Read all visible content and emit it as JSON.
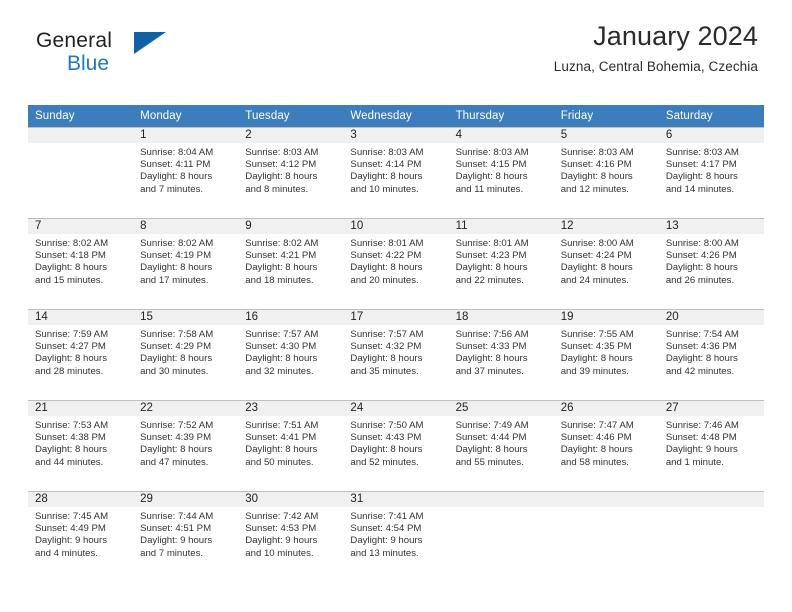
{
  "brand": {
    "name_top": "General",
    "name_bottom": "Blue"
  },
  "header": {
    "title": "January 2024",
    "subtitle": "Luzna, Central Bohemia, Czechia"
  },
  "colors": {
    "header_blue": "#3b7dbd",
    "logo_blue": "#1f78c1",
    "daynum_band": "#f0f0f0",
    "grid_line": "#bfbfbf"
  },
  "weekdays": [
    "Sunday",
    "Monday",
    "Tuesday",
    "Wednesday",
    "Thursday",
    "Friday",
    "Saturday"
  ],
  "weeks": [
    [
      {
        "day": "",
        "sunrise": "",
        "sunset": "",
        "daylight1": "",
        "daylight2": ""
      },
      {
        "day": "1",
        "sunrise": "Sunrise: 8:04 AM",
        "sunset": "Sunset: 4:11 PM",
        "daylight1": "Daylight: 8 hours",
        "daylight2": "and 7 minutes."
      },
      {
        "day": "2",
        "sunrise": "Sunrise: 8:03 AM",
        "sunset": "Sunset: 4:12 PM",
        "daylight1": "Daylight: 8 hours",
        "daylight2": "and 8 minutes."
      },
      {
        "day": "3",
        "sunrise": "Sunrise: 8:03 AM",
        "sunset": "Sunset: 4:14 PM",
        "daylight1": "Daylight: 8 hours",
        "daylight2": "and 10 minutes."
      },
      {
        "day": "4",
        "sunrise": "Sunrise: 8:03 AM",
        "sunset": "Sunset: 4:15 PM",
        "daylight1": "Daylight: 8 hours",
        "daylight2": "and 11 minutes."
      },
      {
        "day": "5",
        "sunrise": "Sunrise: 8:03 AM",
        "sunset": "Sunset: 4:16 PM",
        "daylight1": "Daylight: 8 hours",
        "daylight2": "and 12 minutes."
      },
      {
        "day": "6",
        "sunrise": "Sunrise: 8:03 AM",
        "sunset": "Sunset: 4:17 PM",
        "daylight1": "Daylight: 8 hours",
        "daylight2": "and 14 minutes."
      }
    ],
    [
      {
        "day": "7",
        "sunrise": "Sunrise: 8:02 AM",
        "sunset": "Sunset: 4:18 PM",
        "daylight1": "Daylight: 8 hours",
        "daylight2": "and 15 minutes."
      },
      {
        "day": "8",
        "sunrise": "Sunrise: 8:02 AM",
        "sunset": "Sunset: 4:19 PM",
        "daylight1": "Daylight: 8 hours",
        "daylight2": "and 17 minutes."
      },
      {
        "day": "9",
        "sunrise": "Sunrise: 8:02 AM",
        "sunset": "Sunset: 4:21 PM",
        "daylight1": "Daylight: 8 hours",
        "daylight2": "and 18 minutes."
      },
      {
        "day": "10",
        "sunrise": "Sunrise: 8:01 AM",
        "sunset": "Sunset: 4:22 PM",
        "daylight1": "Daylight: 8 hours",
        "daylight2": "and 20 minutes."
      },
      {
        "day": "11",
        "sunrise": "Sunrise: 8:01 AM",
        "sunset": "Sunset: 4:23 PM",
        "daylight1": "Daylight: 8 hours",
        "daylight2": "and 22 minutes."
      },
      {
        "day": "12",
        "sunrise": "Sunrise: 8:00 AM",
        "sunset": "Sunset: 4:24 PM",
        "daylight1": "Daylight: 8 hours",
        "daylight2": "and 24 minutes."
      },
      {
        "day": "13",
        "sunrise": "Sunrise: 8:00 AM",
        "sunset": "Sunset: 4:26 PM",
        "daylight1": "Daylight: 8 hours",
        "daylight2": "and 26 minutes."
      }
    ],
    [
      {
        "day": "14",
        "sunrise": "Sunrise: 7:59 AM",
        "sunset": "Sunset: 4:27 PM",
        "daylight1": "Daylight: 8 hours",
        "daylight2": "and 28 minutes."
      },
      {
        "day": "15",
        "sunrise": "Sunrise: 7:58 AM",
        "sunset": "Sunset: 4:29 PM",
        "daylight1": "Daylight: 8 hours",
        "daylight2": "and 30 minutes."
      },
      {
        "day": "16",
        "sunrise": "Sunrise: 7:57 AM",
        "sunset": "Sunset: 4:30 PM",
        "daylight1": "Daylight: 8 hours",
        "daylight2": "and 32 minutes."
      },
      {
        "day": "17",
        "sunrise": "Sunrise: 7:57 AM",
        "sunset": "Sunset: 4:32 PM",
        "daylight1": "Daylight: 8 hours",
        "daylight2": "and 35 minutes."
      },
      {
        "day": "18",
        "sunrise": "Sunrise: 7:56 AM",
        "sunset": "Sunset: 4:33 PM",
        "daylight1": "Daylight: 8 hours",
        "daylight2": "and 37 minutes."
      },
      {
        "day": "19",
        "sunrise": "Sunrise: 7:55 AM",
        "sunset": "Sunset: 4:35 PM",
        "daylight1": "Daylight: 8 hours",
        "daylight2": "and 39 minutes."
      },
      {
        "day": "20",
        "sunrise": "Sunrise: 7:54 AM",
        "sunset": "Sunset: 4:36 PM",
        "daylight1": "Daylight: 8 hours",
        "daylight2": "and 42 minutes."
      }
    ],
    [
      {
        "day": "21",
        "sunrise": "Sunrise: 7:53 AM",
        "sunset": "Sunset: 4:38 PM",
        "daylight1": "Daylight: 8 hours",
        "daylight2": "and 44 minutes."
      },
      {
        "day": "22",
        "sunrise": "Sunrise: 7:52 AM",
        "sunset": "Sunset: 4:39 PM",
        "daylight1": "Daylight: 8 hours",
        "daylight2": "and 47 minutes."
      },
      {
        "day": "23",
        "sunrise": "Sunrise: 7:51 AM",
        "sunset": "Sunset: 4:41 PM",
        "daylight1": "Daylight: 8 hours",
        "daylight2": "and 50 minutes."
      },
      {
        "day": "24",
        "sunrise": "Sunrise: 7:50 AM",
        "sunset": "Sunset: 4:43 PM",
        "daylight1": "Daylight: 8 hours",
        "daylight2": "and 52 minutes."
      },
      {
        "day": "25",
        "sunrise": "Sunrise: 7:49 AM",
        "sunset": "Sunset: 4:44 PM",
        "daylight1": "Daylight: 8 hours",
        "daylight2": "and 55 minutes."
      },
      {
        "day": "26",
        "sunrise": "Sunrise: 7:47 AM",
        "sunset": "Sunset: 4:46 PM",
        "daylight1": "Daylight: 8 hours",
        "daylight2": "and 58 minutes."
      },
      {
        "day": "27",
        "sunrise": "Sunrise: 7:46 AM",
        "sunset": "Sunset: 4:48 PM",
        "daylight1": "Daylight: 9 hours",
        "daylight2": "and 1 minute."
      }
    ],
    [
      {
        "day": "28",
        "sunrise": "Sunrise: 7:45 AM",
        "sunset": "Sunset: 4:49 PM",
        "daylight1": "Daylight: 9 hours",
        "daylight2": "and 4 minutes."
      },
      {
        "day": "29",
        "sunrise": "Sunrise: 7:44 AM",
        "sunset": "Sunset: 4:51 PM",
        "daylight1": "Daylight: 9 hours",
        "daylight2": "and 7 minutes."
      },
      {
        "day": "30",
        "sunrise": "Sunrise: 7:42 AM",
        "sunset": "Sunset: 4:53 PM",
        "daylight1": "Daylight: 9 hours",
        "daylight2": "and 10 minutes."
      },
      {
        "day": "31",
        "sunrise": "Sunrise: 7:41 AM",
        "sunset": "Sunset: 4:54 PM",
        "daylight1": "Daylight: 9 hours",
        "daylight2": "and 13 minutes."
      },
      {
        "day": "",
        "sunrise": "",
        "sunset": "",
        "daylight1": "",
        "daylight2": ""
      },
      {
        "day": "",
        "sunrise": "",
        "sunset": "",
        "daylight1": "",
        "daylight2": ""
      },
      {
        "day": "",
        "sunrise": "",
        "sunset": "",
        "daylight1": "",
        "daylight2": ""
      }
    ]
  ]
}
